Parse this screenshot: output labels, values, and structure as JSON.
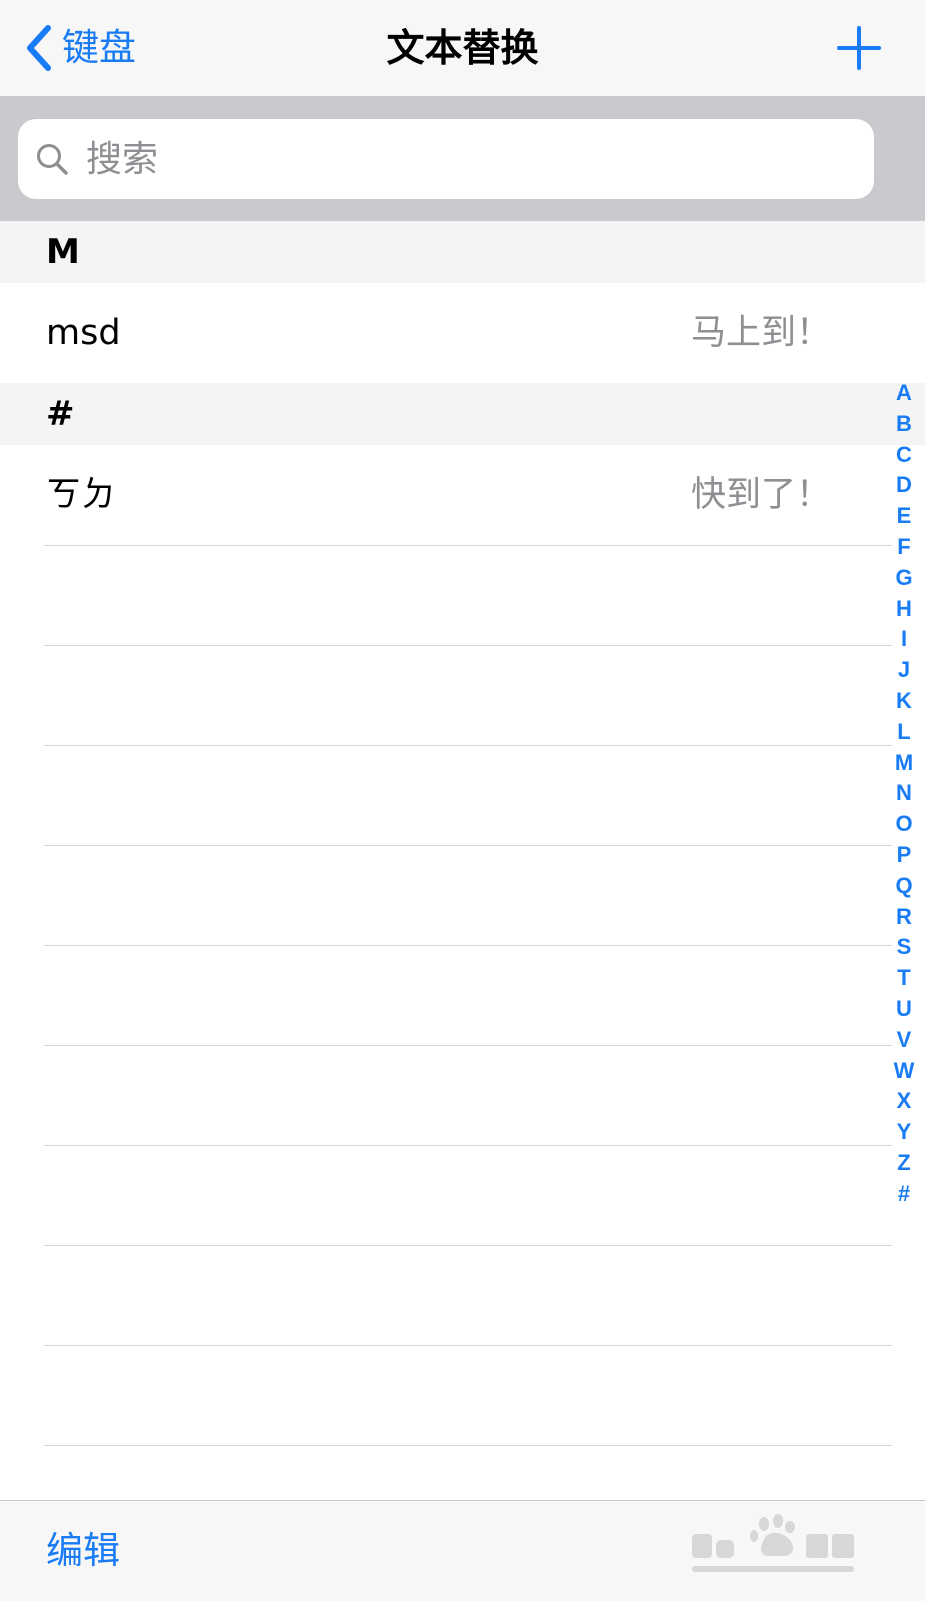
{
  "nav": {
    "back_label": "键盘",
    "title": "文本替换"
  },
  "search": {
    "placeholder": "搜索"
  },
  "sections": [
    {
      "header": "M",
      "items": [
        {
          "shortcut": "msd",
          "phrase": "马上到！"
        }
      ]
    },
    {
      "header": "#",
      "items": [
        {
          "shortcut": "ㄎㄉ",
          "phrase": "快到了！"
        }
      ]
    }
  ],
  "index": [
    "A",
    "B",
    "C",
    "D",
    "E",
    "F",
    "G",
    "H",
    "I",
    "J",
    "K",
    "L",
    "M",
    "N",
    "O",
    "P",
    "Q",
    "R",
    "S",
    "T",
    "U",
    "V",
    "W",
    "X",
    "Y",
    "Z",
    "#"
  ],
  "toolbar": {
    "edit_label": "编辑"
  },
  "colors": {
    "accent": "#1a7cf5",
    "nav_background": "#f7f7f7",
    "search_background": "#c9c9ce",
    "secondary_text": "#8e8e93"
  }
}
